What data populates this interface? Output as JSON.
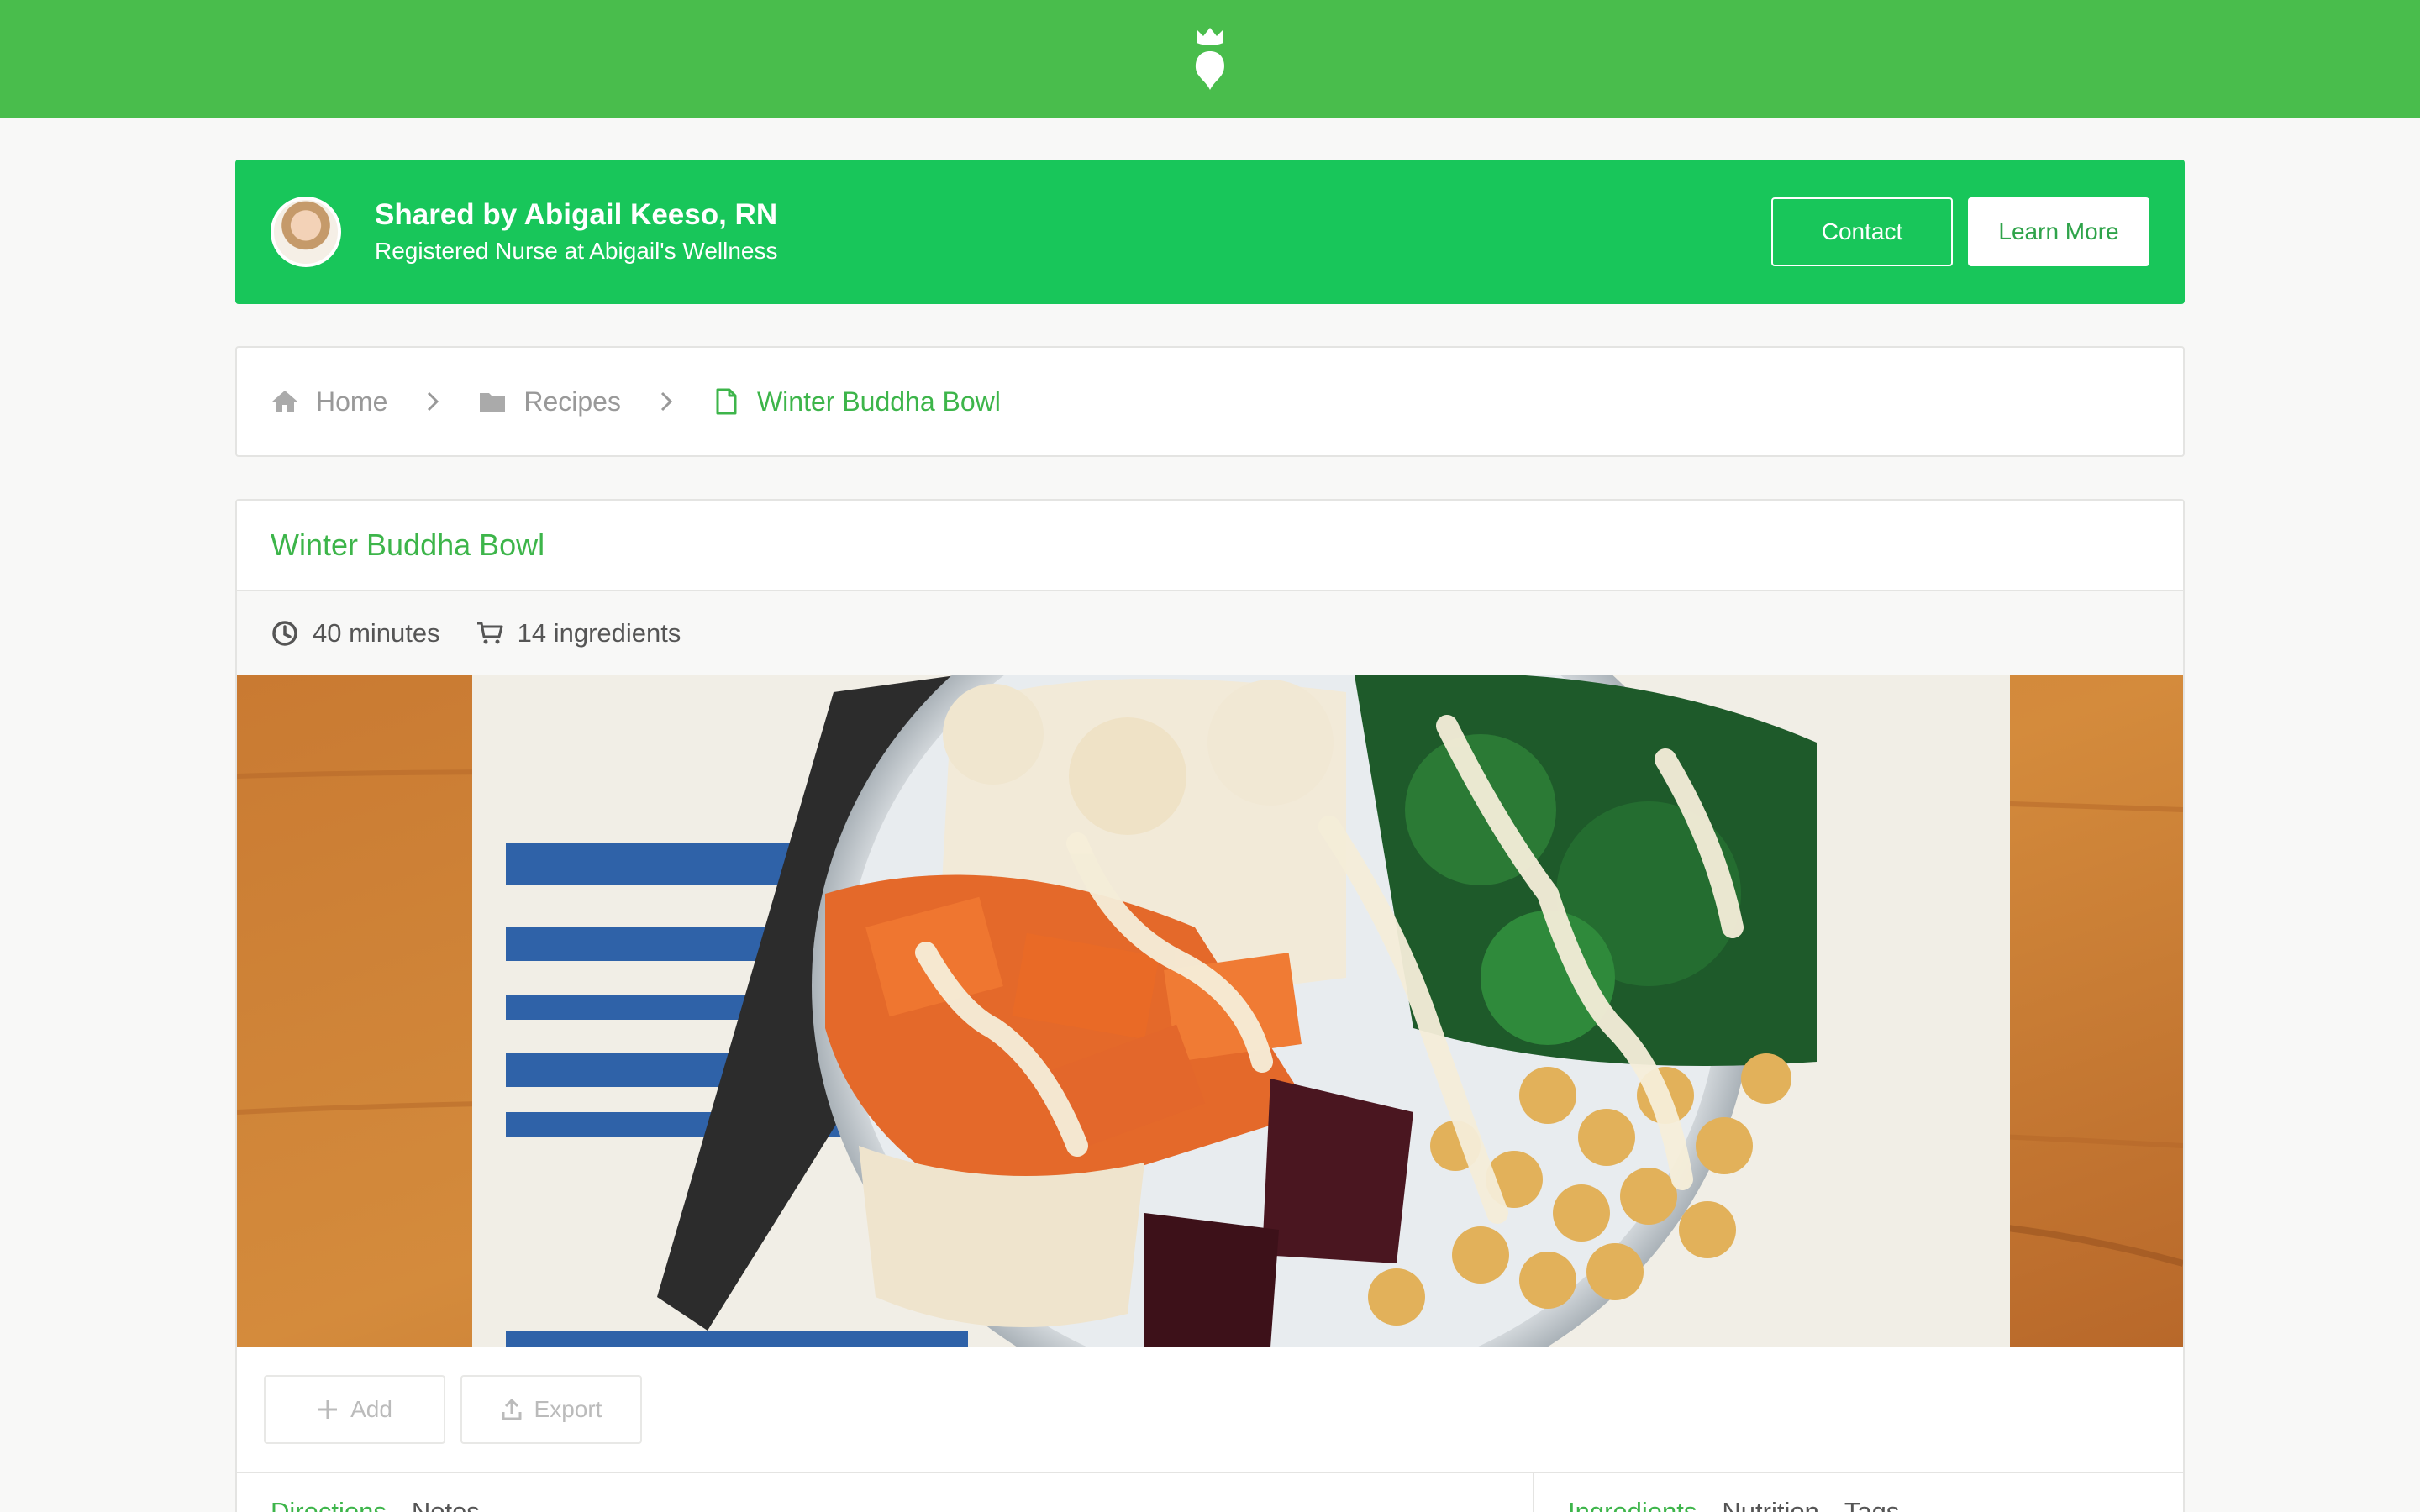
{
  "header": {
    "logo_icon": "beet-logo-icon",
    "brand_color": "#49bd4c"
  },
  "share": {
    "title": "Shared by Abigail Keeso, RN",
    "subtitle": "Registered Nurse at Abigail's Wellness",
    "contact_label": "Contact",
    "learn_more_label": "Learn More",
    "banner_color": "#18c65a"
  },
  "breadcrumb": {
    "home": {
      "label": "Home",
      "icon": "home-icon"
    },
    "recipes": {
      "label": "Recipes",
      "icon": "folder-icon"
    },
    "current": {
      "label": "Winter Buddha Bowl",
      "icon": "file-icon"
    }
  },
  "recipe": {
    "title": "Winter Buddha Bowl",
    "time": "40 minutes",
    "ingredients_count": "14 ingredients"
  },
  "actions": {
    "add_label": "Add",
    "export_label": "Export"
  },
  "tabs": {
    "left": [
      {
        "label": "Directions",
        "active": true
      },
      {
        "label": "Notes",
        "active": false
      }
    ],
    "right": [
      {
        "label": "Ingredients",
        "active": true
      },
      {
        "label": "Nutrition",
        "active": false
      },
      {
        "label": "Tags",
        "active": false
      }
    ]
  }
}
